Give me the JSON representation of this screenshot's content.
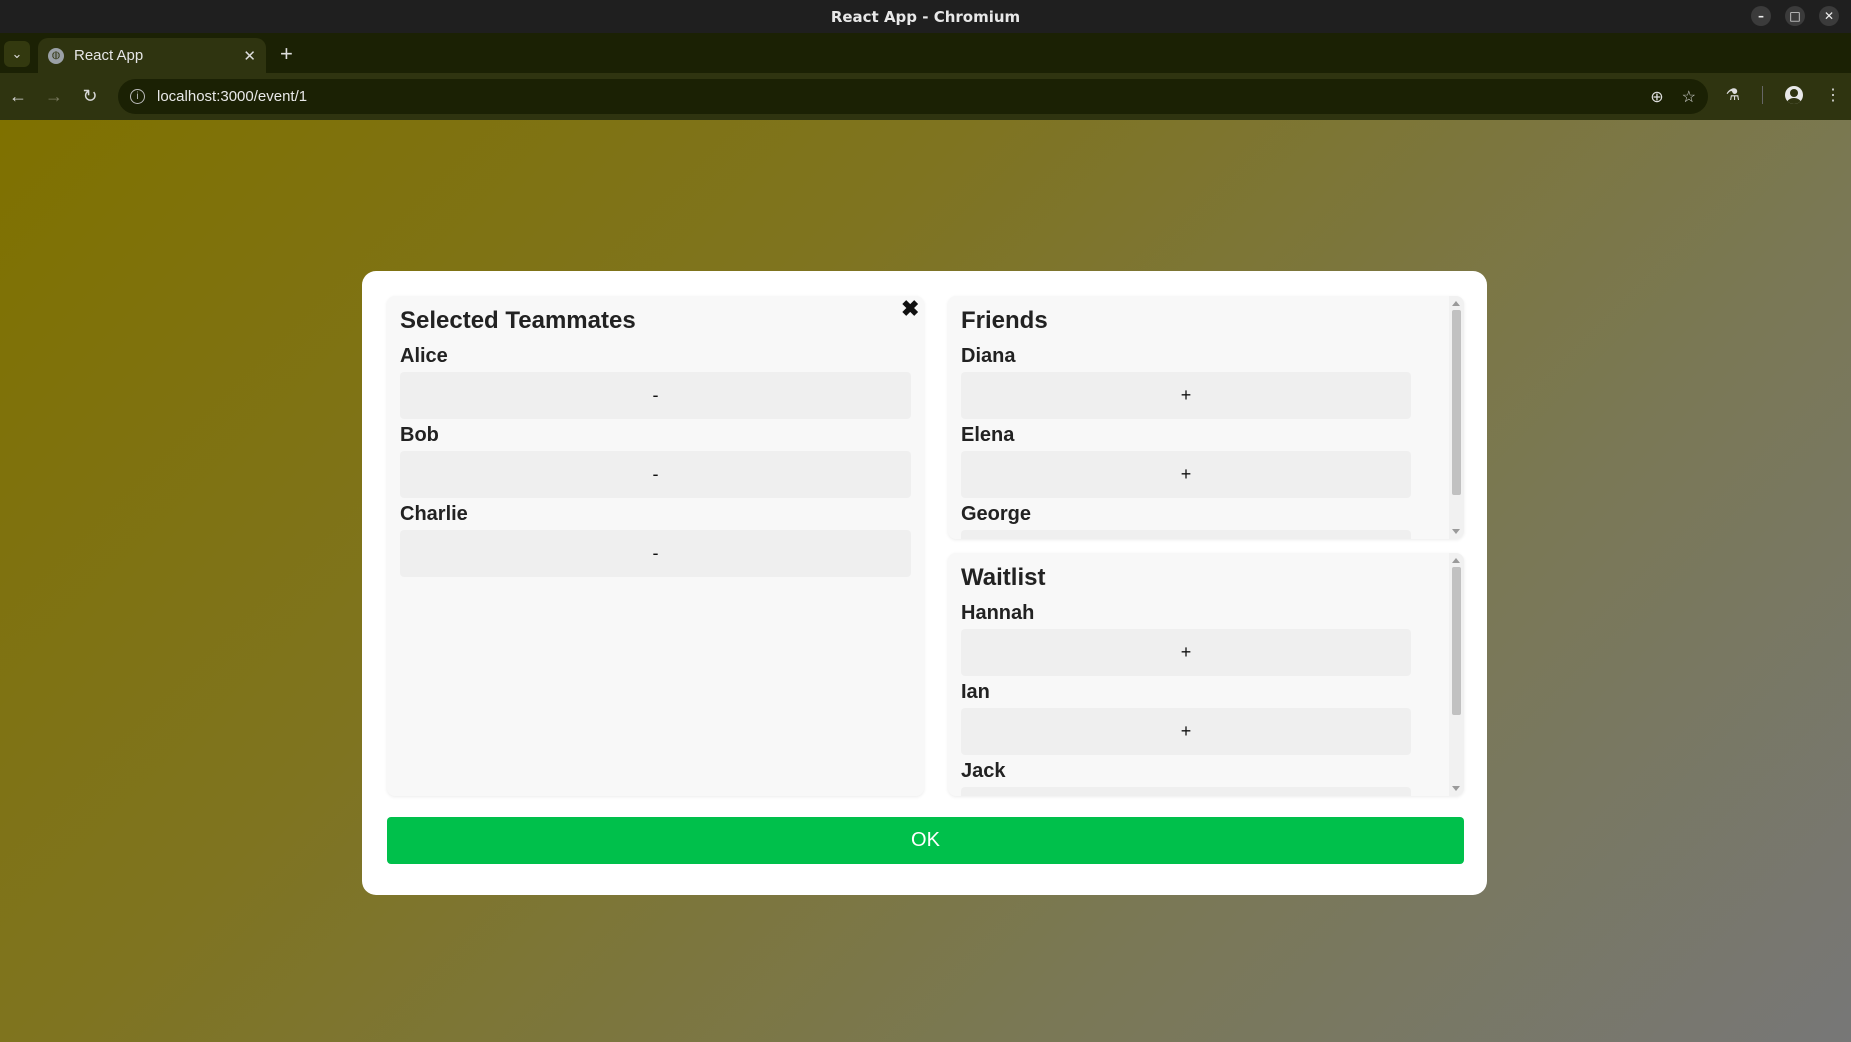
{
  "window": {
    "title": "React App - Chromium",
    "controls": {
      "minimize": "–",
      "maximize": "□",
      "close": "✕"
    }
  },
  "browser": {
    "tab_title": "React App",
    "url": "localhost:3000/event/1"
  },
  "modal": {
    "close_symbol": "✖",
    "selected": {
      "title": "Selected Teammates",
      "members": [
        {
          "name": "Alice",
          "action": "-"
        },
        {
          "name": "Bob",
          "action": "-"
        },
        {
          "name": "Charlie",
          "action": "-"
        }
      ]
    },
    "friends": {
      "title": "Friends",
      "members": [
        {
          "name": "Diana",
          "action": "+"
        },
        {
          "name": "Elena",
          "action": "+"
        },
        {
          "name": "George",
          "action": "+"
        }
      ]
    },
    "waitlist": {
      "title": "Waitlist",
      "members": [
        {
          "name": "Hannah",
          "action": "+"
        },
        {
          "name": "Ian",
          "action": "+"
        },
        {
          "name": "Jack",
          "action": "+"
        }
      ]
    },
    "ok_label": "OK"
  },
  "colors": {
    "ok_button": "#00c04b",
    "background_gradient_start": "#7f7100",
    "background_gradient_end": "#777777"
  }
}
